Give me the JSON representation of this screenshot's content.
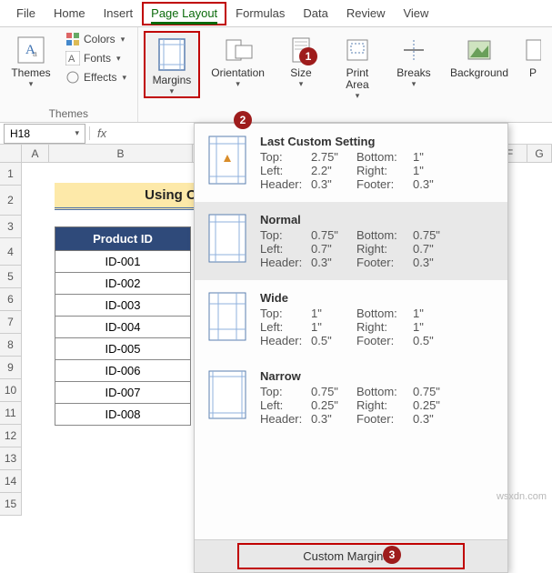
{
  "tabs": {
    "file": "File",
    "home": "Home",
    "insert": "Insert",
    "pagelayout": "Page Layout",
    "formulas": "Formulas",
    "data": "Data",
    "review": "Review",
    "view": "View"
  },
  "ribbon": {
    "themes_group": "Themes",
    "themes": "Themes",
    "colors": "Colors",
    "fonts": "Fonts",
    "effects": "Effects",
    "margins": "Margins",
    "orientation": "Orientation",
    "size": "Size",
    "printarea": "Print\nArea",
    "breaks": "Breaks",
    "background": "Background",
    "p": "P"
  },
  "namebox": "H18",
  "fx": "fx",
  "cols": {
    "a": "A",
    "b": "B",
    "f": "F",
    "g": "G"
  },
  "rows": [
    "1",
    "2",
    "3",
    "4",
    "5",
    "6",
    "7",
    "8",
    "9",
    "10",
    "11",
    "12",
    "13",
    "14",
    "15"
  ],
  "banner": "Using Custom",
  "table": {
    "header": "Product ID",
    "rows": [
      "ID-001",
      "ID-002",
      "ID-003",
      "ID-004",
      "ID-005",
      "ID-006",
      "ID-007",
      "ID-008"
    ]
  },
  "popup": {
    "items": [
      {
        "title": "Last Custom Setting",
        "top_l": "Top:",
        "top_v": "2.75\"",
        "bot_l": "Bottom:",
        "bot_v": "1\"",
        "left_l": "Left:",
        "left_v": "2.2\"",
        "right_l": "Right:",
        "right_v": "1\"",
        "head_l": "Header:",
        "head_v": "0.3\"",
        "foot_l": "Footer:",
        "foot_v": "0.3\""
      },
      {
        "title": "Normal",
        "top_l": "Top:",
        "top_v": "0.75\"",
        "bot_l": "Bottom:",
        "bot_v": "0.75\"",
        "left_l": "Left:",
        "left_v": "0.7\"",
        "right_l": "Right:",
        "right_v": "0.7\"",
        "head_l": "Header:",
        "head_v": "0.3\"",
        "foot_l": "Footer:",
        "foot_v": "0.3\""
      },
      {
        "title": "Wide",
        "top_l": "Top:",
        "top_v": "1\"",
        "bot_l": "Bottom:",
        "bot_v": "1\"",
        "left_l": "Left:",
        "left_v": "1\"",
        "right_l": "Right:",
        "right_v": "1\"",
        "head_l": "Header:",
        "head_v": "0.5\"",
        "foot_l": "Footer:",
        "foot_v": "0.5\""
      },
      {
        "title": "Narrow",
        "top_l": "Top:",
        "top_v": "0.75\"",
        "bot_l": "Bottom:",
        "bot_v": "0.75\"",
        "left_l": "Left:",
        "left_v": "0.25\"",
        "right_l": "Right:",
        "right_v": "0.25\"",
        "head_l": "Header:",
        "head_v": "0.3\"",
        "foot_l": "Footer:",
        "foot_v": "0.3\""
      }
    ],
    "custom": "Custom Margins..."
  },
  "markers": {
    "m1": "1",
    "m2": "2",
    "m3": "3"
  },
  "watermark": "wsxdn.com"
}
